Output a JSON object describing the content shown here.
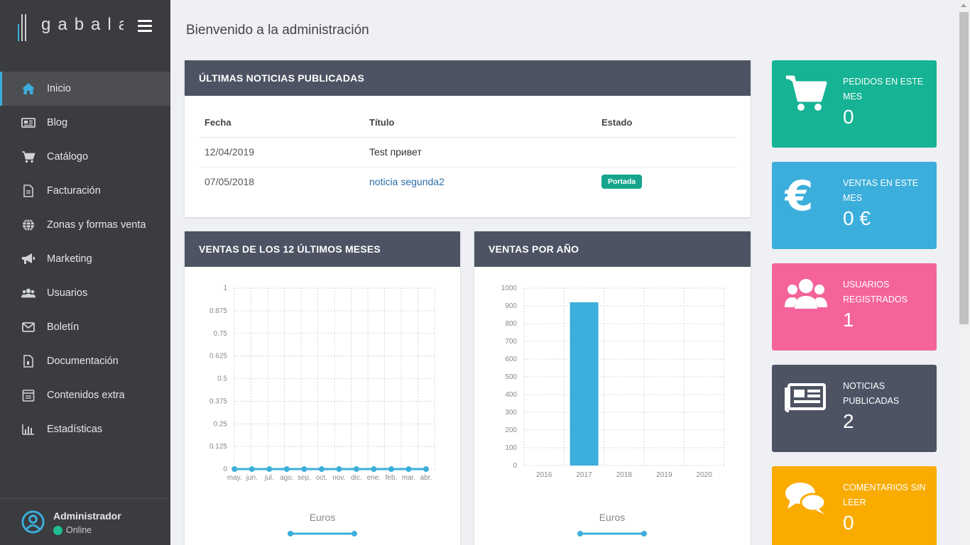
{
  "brand": {
    "logo_text": "gabala"
  },
  "sidebar": {
    "items": [
      {
        "label": "Inicio",
        "icon": "home-icon"
      },
      {
        "label": "Blog",
        "icon": "newspaper-icon"
      },
      {
        "label": "Catálogo",
        "icon": "cart-icon"
      },
      {
        "label": "Facturación",
        "icon": "document-icon"
      },
      {
        "label": "Zonas y formas venta",
        "icon": "globe-icon"
      },
      {
        "label": "Marketing",
        "icon": "megaphone-icon"
      },
      {
        "label": "Usuarios",
        "icon": "users-icon"
      },
      {
        "label": "Boletín",
        "icon": "envelope-icon"
      },
      {
        "label": "Documentación",
        "icon": "file-icon"
      },
      {
        "label": "Contenidos extra",
        "icon": "calendar-icon"
      },
      {
        "label": "Estadísticas",
        "icon": "bar-chart-icon"
      }
    ],
    "active": "Inicio"
  },
  "user": {
    "name": "Administrador",
    "status": "Online"
  },
  "page": {
    "title": "Bienvenido a la administración"
  },
  "news": {
    "heading": "ÚLTIMAS NOTICIAS PUBLICADAS",
    "columns": [
      "Fecha",
      "Título",
      "Estado"
    ],
    "rows": [
      {
        "date": "12/04/2019",
        "title": "Test привет",
        "status": ""
      },
      {
        "date": "07/05/2018",
        "title": "noticia segunda2",
        "status": "Portada"
      }
    ]
  },
  "charts": {
    "monthly_heading": "VENTAS DE LOS 12 ÚLTIMOS MESES",
    "yearly_heading": "VENTAS POR AÑO"
  },
  "chart_data": [
    {
      "type": "line",
      "title": "VENTAS DE LOS 12 ÚLTIMOS MESES",
      "categories": [
        "may.",
        "jun.",
        "jul.",
        "ago.",
        "sep.",
        "oct.",
        "nov.",
        "dic.",
        "ene.",
        "feb.",
        "mar.",
        "abr."
      ],
      "series": [
        {
          "name": "Euros",
          "values": [
            0,
            0,
            0,
            0,
            0,
            0,
            0,
            0,
            0,
            0,
            0,
            0
          ]
        }
      ],
      "y_ticks": [
        "0",
        "0.125",
        "0.25",
        "0.375",
        "0.5",
        "0.625",
        "0.75",
        "0.875",
        "1"
      ],
      "ylim": [
        0,
        1
      ],
      "grid": true,
      "legend": "bottom",
      "color": "#3caedb"
    },
    {
      "type": "bar",
      "title": "VENTAS POR AÑO",
      "categories": [
        "2016",
        "2017",
        "2018",
        "2019",
        "2020"
      ],
      "series": [
        {
          "name": "Euros",
          "values": [
            0,
            920,
            0,
            0,
            0
          ]
        }
      ],
      "y_ticks": [
        "0",
        "100",
        "200",
        "300",
        "400",
        "500",
        "600",
        "700",
        "800",
        "900",
        "1000"
      ],
      "ylim": [
        0,
        1000
      ],
      "grid": true,
      "legend": "bottom",
      "color": "#3caedb"
    }
  ],
  "cards": [
    {
      "title": "PEDIDOS EN ESTE MES",
      "value": "0",
      "color": "#16b394",
      "icon": "cart-icon"
    },
    {
      "title": "VENTAS EN ESTE MES",
      "value": "0 €",
      "color": "#3caedb",
      "icon": "euro-icon"
    },
    {
      "title": "USUARIOS REGISTRADOS",
      "value": "1",
      "color": "#f4649a",
      "icon": "users-icon"
    },
    {
      "title": "NOTICIAS PUBLICADAS",
      "value": "2",
      "color": "#4d5363",
      "icon": "newspaper-icon"
    },
    {
      "title": "COMENTARIOS SIN LEER",
      "value": "0",
      "color": "#f9ab00",
      "icon": "comments-icon"
    }
  ]
}
